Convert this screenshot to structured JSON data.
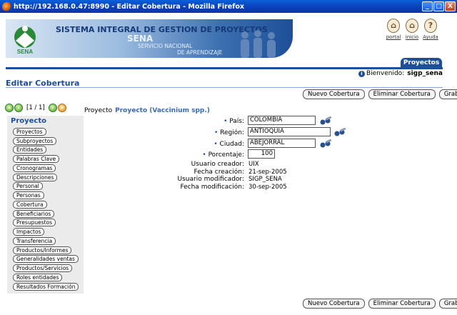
{
  "window": {
    "title": "http://192.168.0.47:8990 - Editar Cobertura - Mozilla Firefox",
    "buttons": [
      "_",
      "□",
      "X"
    ]
  },
  "banner": {
    "system_title": "SISTEMA INTEGRAL DE GESTION DE PROYECTOS",
    "logo_text": "SENA",
    "sena_word": "SENA",
    "sena_line1": "SERVICIO NACIONAL",
    "sena_line2": "DE APRENDIZAJE"
  },
  "top_links": [
    {
      "label": "portal",
      "icon": "portal-icon"
    },
    {
      "label": "inicio",
      "icon": "home-icon"
    },
    {
      "label": "Ayuda",
      "icon": "help-icon"
    }
  ],
  "tab": {
    "label": "Proyectos"
  },
  "welcome": {
    "prefix": "Bienvenido:",
    "user": "sigp_sena"
  },
  "page_title": "Editar Cobertura",
  "actions": {
    "new": "Nuevo Cobertura",
    "delete": "Eliminar Cobertura",
    "save": "Grabar"
  },
  "navigator": {
    "count": "[1 / 1]"
  },
  "project": {
    "label": "Proyecto",
    "name": "Proyecto (Vaccinium spp.)"
  },
  "sidebar": {
    "title": "Proyecto",
    "items": [
      "Proyectos",
      "Subproyectos",
      "Entidades",
      "Palabras Clave",
      "Cronogramas",
      "Descripciones",
      "Personal",
      "Personas",
      "Cobertura",
      "Beneficiarios",
      "Presupuestos",
      "Impactos",
      "Transferencia",
      "Productos/Informes",
      "Generalidades ventas",
      "Productos/Servicios",
      "Roles entidades",
      "Resultados Formación"
    ]
  },
  "form": {
    "pais": {
      "label": "País:",
      "value": "COLOMBIA"
    },
    "region": {
      "label": "Región:",
      "value": "ANTIOQUIA"
    },
    "ciudad": {
      "label": "Ciudad:",
      "value": "ABEJORRAL"
    },
    "porcentaje": {
      "label": "Porcentaje:",
      "value": "100"
    }
  },
  "meta": [
    {
      "label": "Usuario creador:",
      "value": "UIX"
    },
    {
      "label": "Fecha creación:",
      "value": "21-sep-2005"
    },
    {
      "label": "Usuario modificador:",
      "value": "SIGP_SENA"
    },
    {
      "label": "Fecha modificación:",
      "value": "30-sep-2005"
    }
  ],
  "colors": {
    "brand": "#1d4f98",
    "title_bar": "#0b3fb8",
    "sidebar_bg": "#ebebeb"
  }
}
